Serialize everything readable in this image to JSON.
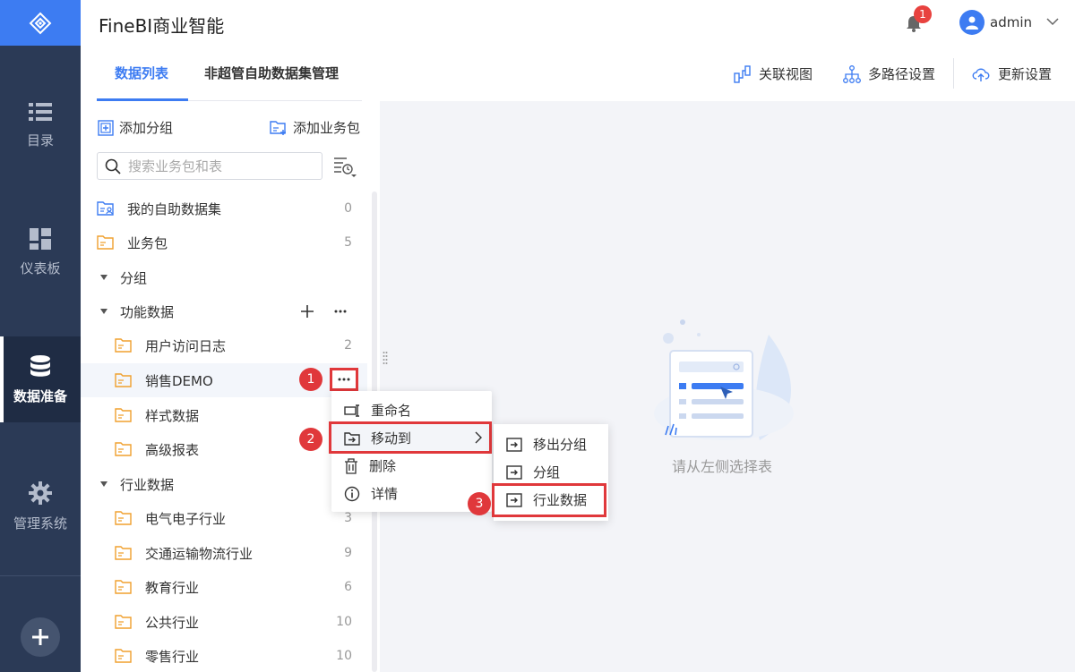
{
  "app": {
    "title": "FineBI商业智能"
  },
  "header": {
    "notification_count": "1",
    "username": "admin"
  },
  "nav": {
    "items": [
      {
        "label": "目录",
        "icon": "list-icon"
      },
      {
        "label": "仪表板",
        "icon": "dashboard-icon"
      },
      {
        "label": "数据准备",
        "icon": "database-icon",
        "active": true
      },
      {
        "label": "管理系统",
        "icon": "gear-icon"
      }
    ],
    "add_icon": "plus-icon"
  },
  "tabs": [
    {
      "label": "数据列表",
      "active": true
    },
    {
      "label": "非超管自助数据集管理",
      "active": false
    }
  ],
  "panel_actions": {
    "add_group": "添加分组",
    "add_package": "添加业务包"
  },
  "search": {
    "placeholder": "搜索业务包和表"
  },
  "tree": {
    "my_datasets": {
      "label": "我的自助数据集",
      "count": "0"
    },
    "packages": {
      "label": "业务包",
      "count": "5"
    },
    "group_root": {
      "label": "分组"
    },
    "group_func": {
      "label": "功能数据"
    },
    "func_items": [
      {
        "label": "用户访问日志",
        "count": "2"
      },
      {
        "label": "销售DEMO",
        "count": ""
      },
      {
        "label": "样式数据",
        "count": ""
      },
      {
        "label": "高级报表",
        "count": ""
      }
    ],
    "group_industry": {
      "label": "行业数据"
    },
    "industry_items": [
      {
        "label": "电气电子行业",
        "count": "3"
      },
      {
        "label": "交通运输物流行业",
        "count": "9"
      },
      {
        "label": "教育行业",
        "count": "6"
      },
      {
        "label": "公共行业",
        "count": "10"
      },
      {
        "label": "零售行业",
        "count": "10"
      }
    ]
  },
  "toolbar": {
    "relation_view": "关联视图",
    "multipath": "多路径设置",
    "update": "更新设置"
  },
  "main": {
    "empty_text": "请从左侧选择表"
  },
  "context_menu": {
    "rename": "重命名",
    "move_to": "移动到",
    "delete": "删除",
    "details": "详情"
  },
  "submenu": {
    "move_out": "移出分组",
    "group": "分组",
    "industry": "行业数据"
  },
  "steps": {
    "one": "1",
    "two": "2",
    "three": "3"
  },
  "colors": {
    "accent": "#3d7cf2",
    "nav_bg": "#2b3a56",
    "highlight_red": "#e0383b",
    "folder": "#f0a02e"
  }
}
